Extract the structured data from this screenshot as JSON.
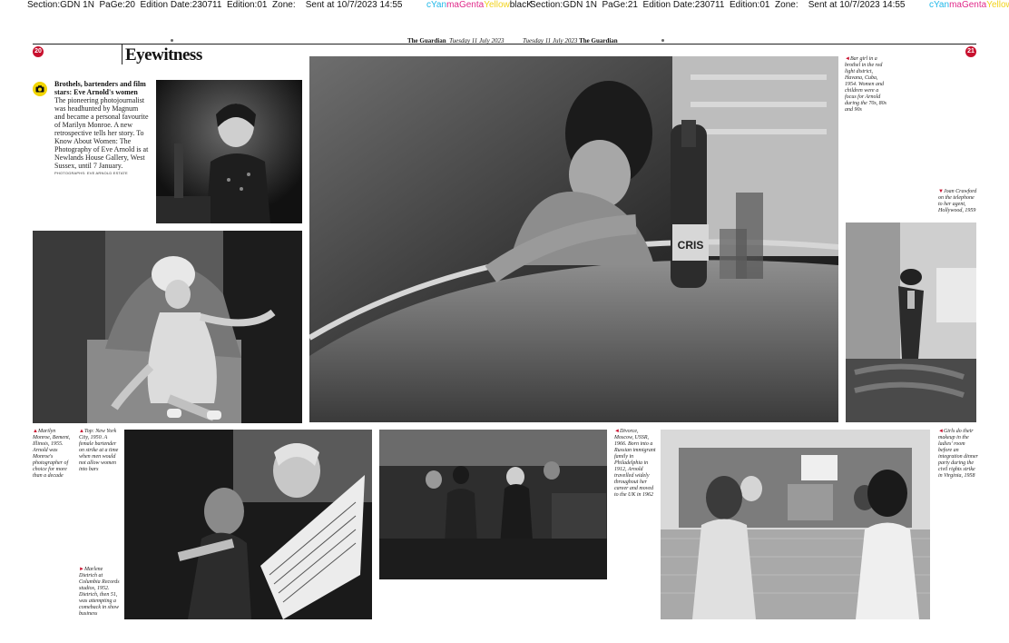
{
  "slug_left": {
    "section": "Section:GDN 1N",
    "page": "PaGe:20",
    "edition_date": "Edition Date:230711",
    "edition": "Edition:01",
    "zone": "Zone:",
    "sent": "Sent at 10/7/2023 14:55"
  },
  "slug_right": {
    "section": "Section:GDN 1N",
    "page": "PaGe:21",
    "edition_date": "Edition Date:230711",
    "edition": "Edition:01",
    "zone": "Zone:",
    "sent": "Sent at 10/7/2023 14:55"
  },
  "registration": {
    "c": "cYan",
    "m": "maGenta",
    "y": "Yellow",
    "k": "blacK"
  },
  "pages": {
    "left_number": "20",
    "right_number": "21",
    "left_paper": "The Guardian",
    "left_date": "Tuesday 11 July 2023",
    "right_date": "Tuesday 11 July 2023",
    "right_paper": "The Guardian"
  },
  "section_title": "Eyewitness",
  "intro": {
    "headline": "Brothels, bartenders and film stars: Eve Arnold's women",
    "body": "The pioneering photojournalist was headhunted by Magnum and became a personal favourite of Marilyn Monroe. A new retrospective tells her story. To Know About Women: The Photography of Eve Arnold is at Newlands House Gallery, West Sussex, until 7 January.",
    "credit": "PHOTOGRAPHS: EVE ARNOLD ESTATE"
  },
  "captions": {
    "bar_girl": {
      "marker": "◄",
      "text": "Bar girl in a brothel in the red light district, Havana, Cuba, 1954. Women and children were a focus for Arnold during the 70s, 80s and 90s"
    },
    "joan": {
      "marker": "▼",
      "text": "Joan Crawford on the telephone to her agent, Hollywood, 1959"
    },
    "marilyn": {
      "marker": "▲",
      "text": "Marilyn Monroe, Bement, Illinois, 1955. Arnold was Monroe's photographer of choice for more than a decade"
    },
    "bartender": {
      "marker": "▲",
      "text": "Top: New York City, 1950. A female bartender on strike at a time when men would not allow women into bars"
    },
    "marlene": {
      "marker": "►",
      "text": "Marlene Dietrich at Columbia Records studios, 1952. Dietrich, then 51, was attempting a comeback in show business"
    },
    "divorce": {
      "marker": "◄",
      "text": "Divorce, Moscow, USSR, 1966. Born into a Russian immigrant family in Philadelphia in 1912, Arnold travelled widely throughout her career and moved to the UK in 1962"
    },
    "makeup": {
      "marker": "◄",
      "text": "Girls do their makeup in the ladies' room before an integration dinner party during the civil rights strike in Virginia, 1958"
    }
  },
  "photo_text": {
    "bottle_label": "CRIS"
  },
  "colors": {
    "accent_red": "#c8102e",
    "icon_yellow": "#f2d500"
  }
}
